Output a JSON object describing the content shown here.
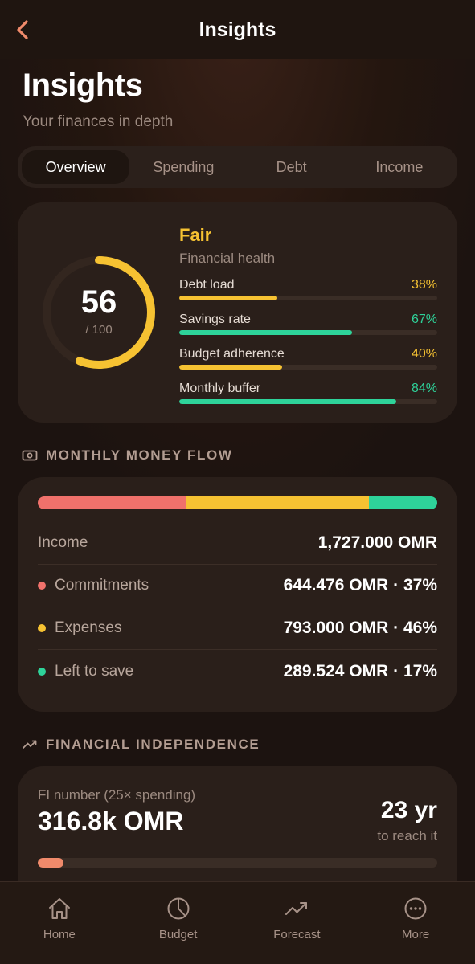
{
  "nav": {
    "title": "Insights",
    "back_icon": "chevron-left-icon"
  },
  "header": {
    "title": "Insights",
    "subtitle": "Your finances in depth"
  },
  "tabs": [
    {
      "label": "Overview",
      "active": true
    },
    {
      "label": "Spending",
      "active": false
    },
    {
      "label": "Debt",
      "active": false
    },
    {
      "label": "Income",
      "active": false
    }
  ],
  "health": {
    "score": "56",
    "max": "/ 100",
    "score_fraction": 0.56,
    "label": "Fair",
    "subtitle": "Financial health",
    "metrics": [
      {
        "name": "Debt load",
        "pct": "38%",
        "value": 0.38,
        "color": "#f6c232"
      },
      {
        "name": "Savings rate",
        "pct": "67%",
        "value": 0.67,
        "color": "#2ed39a"
      },
      {
        "name": "Budget adherence",
        "pct": "40%",
        "value": 0.4,
        "color": "#f6c232"
      },
      {
        "name": "Monthly buffer",
        "pct": "84%",
        "value": 0.84,
        "color": "#2ed39a"
      }
    ]
  },
  "money_flow": {
    "section_title": "MONTHLY MONEY FLOW",
    "section_icon": "cash-icon",
    "segments": [
      {
        "name": "Commitments",
        "fraction": 0.37,
        "color": "#f0716b"
      },
      {
        "name": "Expenses",
        "fraction": 0.46,
        "color": "#f6c232"
      },
      {
        "name": "Left to save",
        "fraction": 0.17,
        "color": "#2ed39a"
      }
    ],
    "income_label": "Income",
    "income_value": "1,727.000 OMR",
    "rows": [
      {
        "label": "Commitments",
        "value": "644.476 OMR · 37%",
        "color": "#f0716b"
      },
      {
        "label": "Expenses",
        "value": "793.000 OMR · 46%",
        "color": "#f6c232"
      },
      {
        "label": "Left to save",
        "value": "289.524 OMR · 17%",
        "color": "#2ed39a"
      }
    ]
  },
  "fi": {
    "section_title": "FINANCIAL INDEPENDENCE",
    "section_icon": "trend-up-icon",
    "label": "FI number (25× spending)",
    "number": "316.8k OMR",
    "years": "23 yr",
    "years_sub": "to reach it",
    "progress": 0.065,
    "progress_color": "#f08a6b"
  },
  "tabbar": [
    {
      "label": "Home",
      "icon": "home-icon"
    },
    {
      "label": "Budget",
      "icon": "pie-chart-icon"
    },
    {
      "label": "Forecast",
      "icon": "trend-up-icon"
    },
    {
      "label": "More",
      "icon": "more-icon"
    }
  ]
}
